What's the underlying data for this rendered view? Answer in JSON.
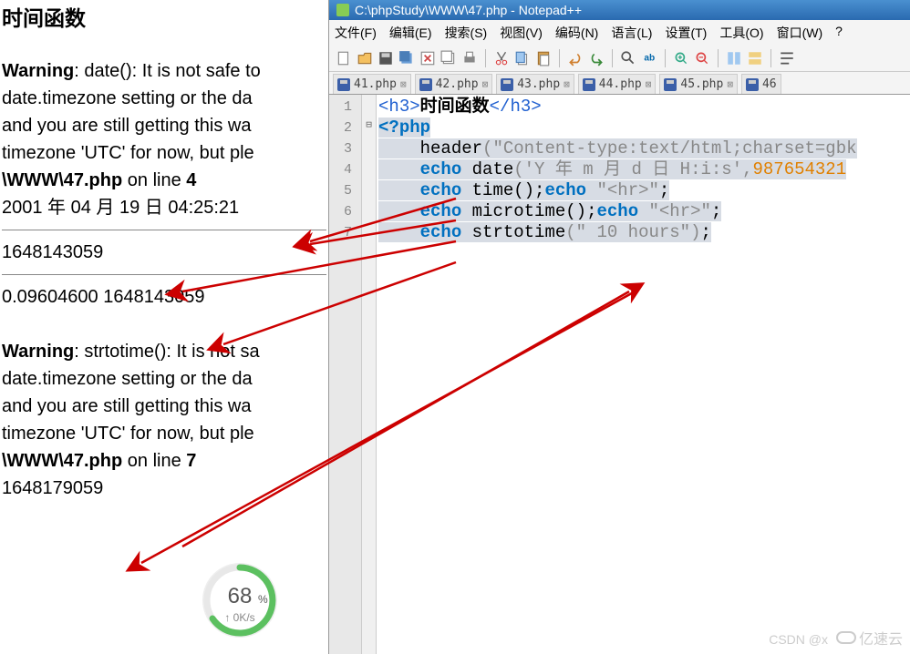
{
  "browser": {
    "title": "时间函数",
    "warning1_label": "Warning",
    "warning1_text": ": date(): It is not safe to",
    "line2": "date.timezone setting or the da",
    "line3": "and you are still getting this wa",
    "line4": "timezone 'UTC' for now, but ple",
    "path": "\\WWW\\47.php",
    "online": " on line ",
    "ln_a": "4",
    "date_output": "2001 年 04 月 19 日 04:25:21",
    "time_output": "1648143059",
    "microtime_output": "0.09604600 1648143059",
    "warning2_label": "Warning",
    "warning2_text": ": strtotime(): It is not sa",
    "ln_b": "7",
    "strtotime_output": "1648179059"
  },
  "npp": {
    "title": "C:\\phpStudy\\WWW\\47.php - Notepad++",
    "menus": [
      "文件(F)",
      "编辑(E)",
      "搜索(S)",
      "视图(V)",
      "编码(N)",
      "语言(L)",
      "设置(T)",
      "工具(O)",
      "窗口(W)",
      "?"
    ],
    "tabs": [
      "41.php",
      "42.php",
      "43.php",
      "44.php",
      "45.php",
      "46"
    ],
    "code": {
      "lines": [
        "1",
        "2",
        "3",
        "4",
        "5",
        "6",
        "7"
      ],
      "l1_open": "<h3>",
      "l1_txt": "时间函数",
      "l1_close": "</h3>",
      "l2": "<?php",
      "l3_fn": "header",
      "l3_str": "(\"Content-type:text/html;charset=gbk",
      "l4_kw": "echo ",
      "l4_fn": "date",
      "l4_str": "('Y 年 m 月 d 日 H:i:s',",
      "l4_num": "987654321",
      "l5_kw": "echo ",
      "l5_fn": "time",
      "l5_rest": "();",
      "l5_kw2": "echo ",
      "l5_str": "\"<hr>\"",
      "l5_end": ";",
      "l6_kw": "echo ",
      "l6_fn": "microtime",
      "l6_rest": "();",
      "l6_kw2": "echo ",
      "l6_str": "\"<hr>\"",
      "l6_end": ";",
      "l7_kw": "echo ",
      "l7_fn": "strtotime",
      "l7_str": "(\" 10 hours\")",
      "l7_end": ";"
    }
  },
  "widget": {
    "percent": "68%",
    "speed": "0K/s"
  },
  "watermarks": {
    "csdn": "CSDN @x",
    "yi": "亿速云"
  }
}
